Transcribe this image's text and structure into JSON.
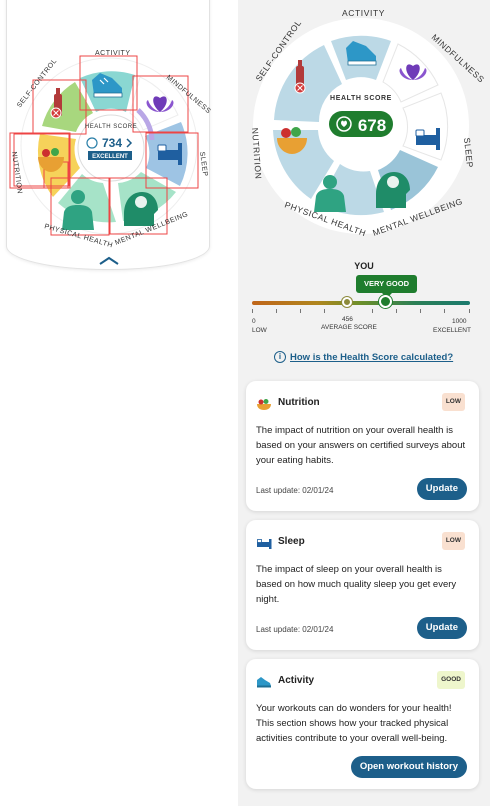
{
  "left_wheel": {
    "categories": [
      "ACTIVITY",
      "MINDFULNESS",
      "SLEEP",
      "MENTAL WELLBEING",
      "PHYSICAL HEALTH",
      "NUTRITION",
      "SELF-CONTROL"
    ],
    "score_label": "HEALTH SCORE",
    "score": "734",
    "rating": "EXCELLENT",
    "chevron": "chevron-right-icon",
    "collapse_icon": "chevron-up-icon"
  },
  "right_wheel": {
    "categories": [
      "ACTIVITY",
      "MINDFULNESS",
      "SLEEP",
      "MENTAL WELLBEING",
      "PHYSICAL HEALTH",
      "NUTRITION",
      "SELF-CONTROL"
    ],
    "score_label": "HEALTH SCORE",
    "score": "678"
  },
  "slider": {
    "you_label": "YOU",
    "rating": "VERY GOOD",
    "user_score": 678,
    "average_score": 456,
    "min_value": "0",
    "min_label": "LOW",
    "average_value": "456",
    "average_label": "AVERAGE SCORE",
    "max_value": "1000",
    "max_label": "EXCELLENT"
  },
  "info_link": "How is the Health Score calculated?",
  "cards": [
    {
      "title": "Nutrition",
      "badge": "LOW",
      "description": "The impact of nutrition on your overall health is based on your answers on certified surveys about your eating habits.",
      "date": "Last update: 02/01/24",
      "button": "Update",
      "icon": "nutrition-icon"
    },
    {
      "title": "Sleep",
      "badge": "LOW",
      "description": "The impact of sleep on your overall health is based on how much quality sleep you get every night.",
      "date": "Last update: 02/01/24",
      "button": "Update",
      "icon": "bed-icon"
    },
    {
      "title": "Activity",
      "badge": "GOOD",
      "description": "Your workouts can do wonders for your health! This section shows how your tracked physical activities contribute to your overall well-being.",
      "button": "Open workout history",
      "icon": "sneaker-icon"
    }
  ],
  "colors": {
    "accent_blue": "#1d5f8a",
    "very_good_green": "#1f7d2e",
    "wheel_light_blue": "#bcd9e6",
    "wheel_dark_blue": "#9ac4d8",
    "excellent_teal": "#a6e3c8",
    "low_badge": "#f9e0d0",
    "good_badge": "#eef6cc"
  }
}
